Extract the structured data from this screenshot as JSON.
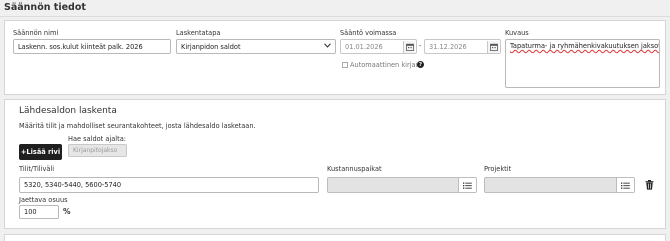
{
  "page": {
    "title": "Säännön tiedot"
  },
  "rule": {
    "name_label": "Säännön nimi",
    "name_value": "Laskenn. sos.kulut kiinteät palk. 2026",
    "method_label": "Laskentatapa",
    "method_value": "Kirjanpidon saldot",
    "validity_label": "Sääntö voimassa",
    "date_from": "01.01.2026",
    "date_separator": "-",
    "date_to": "31.12.2026",
    "auto_post_label": "Automaattinen kirjaus",
    "description_label": "Kuvaus",
    "description_value": "Tapaturma- ja ryhmähenkivakuutuksen jaksotus"
  },
  "source": {
    "title": "Lähdesaldon laskenta",
    "help_text": "Määritä tilit ja mahdolliset seurantakohteet, josta lähdesaldo lasketaan.",
    "add_row_label": "+Lisää rivi",
    "fetch_label": "Hae saldot ajalta:",
    "fetch_value": "Kirjanpitojakso",
    "accounts_label": "Tilit/Tiliväli",
    "accounts_value": "5320, 5340-5440, 5600-5740",
    "cost_centers_label": "Kustannuspaikat",
    "cost_centers_value": "",
    "projects_label": "Projektit",
    "projects_value": "",
    "share_label": "Jaettava osuus",
    "share_value": "100",
    "share_unit": "%"
  },
  "icons": [
    "calendar-icon",
    "chevron-down-icon",
    "help-icon",
    "list-icon",
    "trash-icon",
    "checkbox-icon"
  ]
}
